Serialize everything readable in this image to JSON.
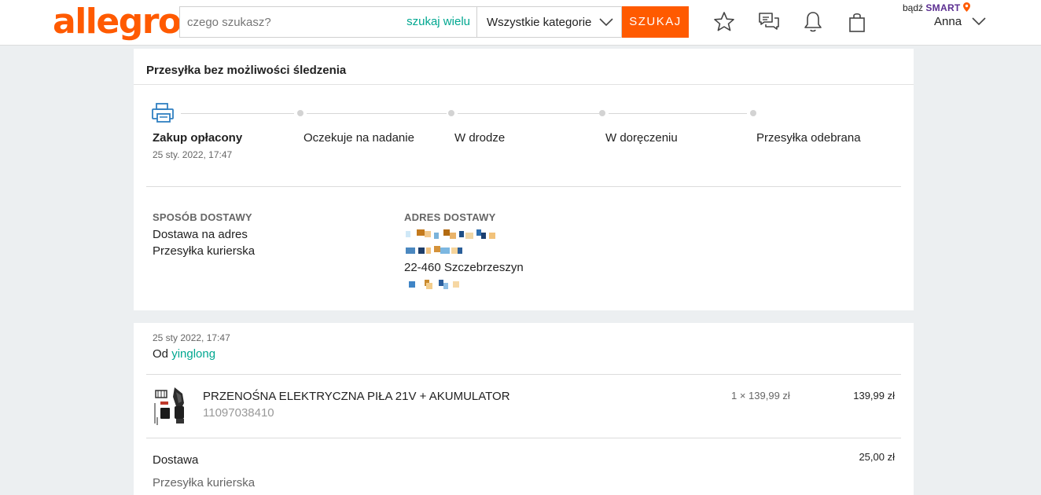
{
  "header": {
    "logo_text": "allegro",
    "search_placeholder": "czego szukasz?",
    "search_many_label": "szukaj wielu",
    "category_label": "Wszystkie kategorie",
    "search_button_label": "SZUKAJ",
    "smart_prefix": "bądź",
    "smart_brand": "SMART",
    "user_name": "Anna",
    "icons": [
      "star-icon",
      "chat-icon",
      "bell-icon",
      "bag-icon",
      "chevron-down-icon"
    ],
    "accent_color": "#ff5a00",
    "link_color": "#00a790"
  },
  "shipment": {
    "title": "Przesyłka bez możliwości śledzenia",
    "status_icon": "printer-icon",
    "steps": [
      {
        "label": "Zakup opłacony",
        "date": "25 sty. 2022, 17:47",
        "active": true
      },
      {
        "label": "Oczekuje na nadanie"
      },
      {
        "label": "W drodze"
      },
      {
        "label": "W doręczeniu"
      },
      {
        "label": "Przesyłka odebrana"
      }
    ],
    "delivery_method": {
      "label": "SPOSÓB DOSTAWY",
      "line1": "Dostawa na adres",
      "line2": "Przesyłka kurierska"
    },
    "delivery_address": {
      "label": "ADRES DOSTAWY",
      "postal_city": "22-460 Szczebrzeszyn"
    }
  },
  "order": {
    "date": "25 sty 2022, 17:47",
    "from_label": "Od",
    "seller": "yinglong",
    "item": {
      "name": "PRZENOŚNA ELEKTRYCZNA PIŁA 21V + AKUMULATOR",
      "id": "11097038410",
      "qty_price": "1 × 139,99 zł",
      "total": "139,99 zł"
    },
    "shipping": {
      "label": "Dostawa",
      "price": "25,00 zł",
      "method": "Przesyłka kurierska"
    }
  }
}
